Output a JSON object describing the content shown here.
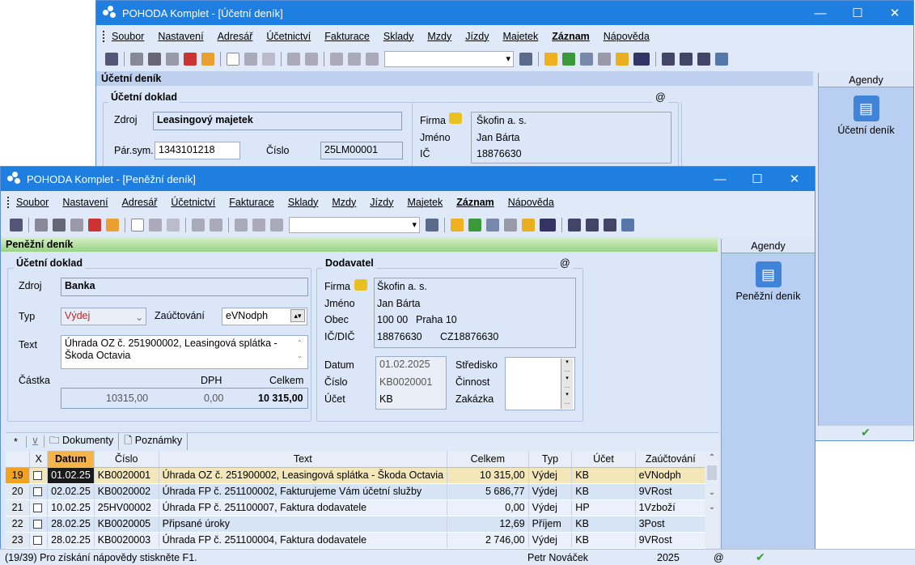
{
  "back": {
    "title": "POHODA Komplet - [Účetní deník]",
    "menu": [
      "Soubor",
      "Nastavení",
      "Adresář",
      "Účetnictví",
      "Fakturace",
      "Sklady",
      "Mzdy",
      "Jízdy",
      "Majetek",
      "Záznam",
      "Nápověda"
    ],
    "section": "Účetní deník",
    "group": "Účetní doklad",
    "zdroj_label": "Zdroj",
    "zdroj": "Leasingový majetek",
    "parsym_label": "Pár.sym.",
    "parsym": "1343101218",
    "cislo_label": "Číslo",
    "cislo": "25LM00001",
    "firma_label": "Firma",
    "firma": "Škofin a. s.",
    "jmeno_label": "Jméno",
    "jmeno": "Jan Bárta",
    "ic_label": "IČ",
    "ic": "18876630",
    "at": "@",
    "agendy": "Agendy",
    "agenda_item": "Účetní deník"
  },
  "front": {
    "title": "POHODA Komplet - [Peněžní deník]",
    "menu": [
      "Soubor",
      "Nastavení",
      "Adresář",
      "Účetnictví",
      "Fakturace",
      "Sklady",
      "Mzdy",
      "Jízdy",
      "Majetek",
      "Záznam",
      "Nápověda"
    ],
    "section": "Peněžní deník",
    "group1": "Účetní doklad",
    "group2": "Dodavatel",
    "at": "@",
    "zdroj_label": "Zdroj",
    "zdroj": "Banka",
    "typ_label": "Typ",
    "typ": "Výdej",
    "zauct_label": "Zaúčtování",
    "zauct": "eVNodph",
    "text_label": "Text",
    "text": "Úhrada OZ č. 251900002, Leasingová splátka - Škoda Octavia",
    "castka_label": "Částka",
    "dph_label": "DPH",
    "celkem_label": "Celkem",
    "castka": "10315,00",
    "dph": "0,00",
    "celkem": "10 315,00",
    "firma_label": "Firma",
    "firma": "Škofin a. s.",
    "jmeno_label": "Jméno",
    "jmeno": "Jan Bárta",
    "obec_label": "Obec",
    "psc": "100 00",
    "obec": "Praha 10",
    "icdic_label": "IČ/DIČ",
    "ic": "18876630",
    "dic": "CZ18876630",
    "datum_label": "Datum",
    "datum": "01.02.2025",
    "cislo_label": "Číslo",
    "cislo": "KB0020001",
    "ucet_label": "Účet",
    "ucet": "KB",
    "stredisko_label": "Středisko",
    "cinnost_label": "Činnost",
    "zakazka_label": "Zakázka",
    "agendy": "Agendy",
    "agenda_item": "Peněžní deník",
    "tabs": {
      "star": "*",
      "dokumenty": "Dokumenty",
      "poznamky": "Poznámky"
    },
    "columns": [
      "X",
      "Datum",
      "Číslo",
      "Text",
      "Celkem",
      "Typ",
      "Účet",
      "Zaúčtování"
    ],
    "rows": [
      {
        "n": "19",
        "datum": "01.02.25",
        "cislo": "KB0020001",
        "text": "Úhrada OZ č. 251900002, Leasingová splátka - Škoda Octavia",
        "celkem": "10 315,00",
        "typ": "Výdej",
        "ucet": "KB",
        "zauct": "eVNodph"
      },
      {
        "n": "20",
        "datum": "02.02.25",
        "cislo": "KB0020002",
        "text": "Úhrada FP č. 251100002, Fakturujeme Vám účetní služby",
        "celkem": "5 686,77",
        "typ": "Výdej",
        "ucet": "KB",
        "zauct": "9VRost"
      },
      {
        "n": "21",
        "datum": "10.02.25",
        "cislo": "25HV00002",
        "text": "Úhrada FP č. 251100007, Faktura dodavatele",
        "celkem": "0,00",
        "typ": "Výdej",
        "ucet": "HP",
        "zauct": "1Vzboží"
      },
      {
        "n": "22",
        "datum": "28.02.25",
        "cislo": "KB0020005",
        "text": "Připsané úroky",
        "celkem": "12,69",
        "typ": "Příjem",
        "ucet": "KB",
        "zauct": "3Post"
      },
      {
        "n": "23",
        "datum": "28.02.25",
        "cislo": "KB0020003",
        "text": "Úhrada FP č. 251100004, Faktura dodavatele",
        "celkem": "2 746,00",
        "typ": "Výdej",
        "ucet": "KB",
        "zauct": "9VRost"
      }
    ]
  },
  "status": {
    "help": "(19/39) Pro získání nápovědy stiskněte F1.",
    "user": "Petr Nováček",
    "year": "2025",
    "at": "@"
  }
}
